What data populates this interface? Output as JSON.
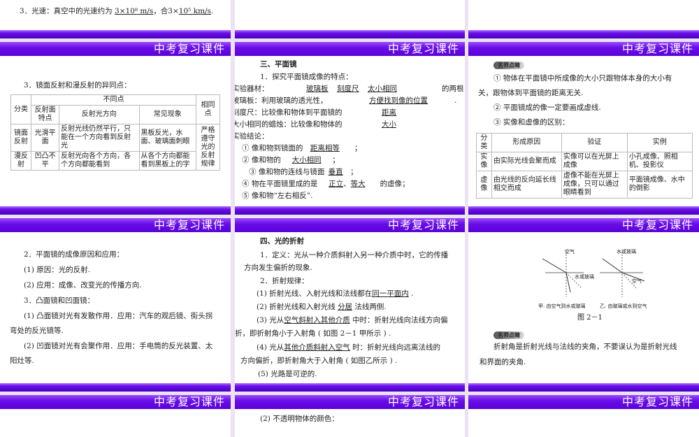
{
  "header_title": "中考复习课件",
  "slide_top_left": {
    "prefix": "3．光速：真空中的光速约为 ",
    "v1": "3×10⁸ m/s",
    "mid": "，合3×",
    "v2": "10⁵ km/s",
    "end": "."
  },
  "slide_r1c0": {
    "heading": "3．镜面反射和漫反射的异同点：",
    "table": {
      "h_class": "分类",
      "h_diff": "不同点",
      "h_same": "相同点",
      "h_surface": "反射面特点",
      "h_dir": "反射光方向",
      "h_phen": "常见现象",
      "rows": [
        {
          "cls": "镜面反射",
          "surface": "光滑平面",
          "dir": "反射光线仍然平行，只能在一个方向看到反射光",
          "phen": "黑板反光，水面、玻璃面刺眼"
        },
        {
          "cls": "漫反射",
          "surface": "凹凸不平",
          "dir": "反射光向各个方向，各个方向都能看到",
          "phen": "从各个方向都能看到黑板上的字"
        }
      ],
      "same": "严格遵守光的反射规律"
    }
  },
  "slide_r1c1": {
    "heading": "三、平面镜",
    "l1": "1．探究平面镜成像的特点：",
    "l2a": "实验器材：",
    "l2b": "玻璃板",
    "l2c": "刻度尺",
    "l2d": "太小相同",
    "l2e": "的两根",
    "l3a": "玻璃板：利用玻璃的透光性，",
    "l3b": "方便找到像的位置",
    "l3c": ".",
    "l4a": "刻度尺：比较像和物体到平面镜的",
    "l4b": "距离",
    "l5a": "大小相同的蜡烛：比较像和物体的",
    "l5b": "大小",
    "l6": "实验结论：",
    "c1a": "① 像和物到镜面的",
    "c1b": "距离相等",
    "c1c": "；",
    "c2a": "② 像和物的",
    "c2b": "大小相同",
    "c2c": "；",
    "c3a": "③ 像和物的连线与镜面",
    "c3b": "垂直",
    "c3c": "；",
    "c4a": "④ 物在平面镜里成的是",
    "c4b": "正立",
    "c4c": "、",
    "c4d": "等大",
    "c4e": "的虚像；",
    "c5": "⑤ 像和物“左右相反”."
  },
  "slide_r1c2": {
    "tip": "名师点睛",
    "l1": "① 物体在平面镜中所成像的大小只跟物体本身的大小有",
    "l2": "关，跟物体到平面镜的距离无关.",
    "l3": "② 平面镜成的像一定要画成虚线.",
    "l4": "③ 实像和虚像的区别：",
    "table": {
      "headers": [
        "分类",
        "形成原因",
        "验证",
        "实例"
      ],
      "rows": [
        [
          "实像",
          "由实际光线会聚而成",
          "实像可以在光屏上成像",
          "小孔成像、照相机、投影仪"
        ],
        [
          "虚像",
          "由光线的反向延长线相交而成",
          "虚像不能在光屏上成像，只可以通过眼睛看到",
          "平面镜成像、水中的倒影"
        ]
      ]
    }
  },
  "slide_r2c0": {
    "l1": "2．平面镜的成像原因和应用：",
    "l2": "(1) 原因：光的反射.",
    "l3": "(2) 应用：成像、改变光的传播方向.",
    "l4": "3．凸面镜和凹面镜：",
    "l5": "(1) 凸面镜对光有发散作用．应用：汽车的观后镜、街头拐",
    "l6": "弯处的反光镜等.",
    "l7": "(2) 凹面镜对光有会聚作用．应用：手电筒的反光装置、太",
    "l8": "阳灶等."
  },
  "slide_r2c1": {
    "heading": "四、光的折射",
    "l1": "1．定义：光从一种介质斜射入另一种介质中时，它的传播",
    "l2": "方向发生偏折的现象.",
    "l3": "2．折射规律：",
    "r1a": "(1) 折射光线、入射光线和法线都在",
    "r1b": "同一平面内",
    "r1c": ".",
    "r2a": "(2) 折射光线和入射光线",
    "r2b": "分居",
    "r2c": "法线两侧.",
    "r3a": "(3) 光从",
    "r3b": "空气斜射入其他介质",
    "r3c": "中时：折射光线向法线方向偏",
    "r3d": "折，即折射角小于入射角 ( 如图  2－1 甲所示 ) .",
    "r4a": "(4) 光从",
    "r4b": "其他介质斜射入空气",
    "r4c": "时：折射光线向远离法线的",
    "r4d": "方向偏折，即折射角大于入射角 ( 如图乙所示 ) .",
    "r5": "(5) 光路是可逆的."
  },
  "slide_r2c2": {
    "fig_a_top": "空气",
    "fig_a_bottom": "水或玻璃",
    "fig_a_caption": "甲. 由空气到水或玻璃",
    "fig_b_top": "水或玻璃",
    "fig_b_bottom": "空气",
    "fig_b_caption": "乙. 由玻璃或水到空气",
    "fig_label": "图  2－1",
    "tip": "名师点睛",
    "l1": "折射角是折射光线与法线的夹角，不要误认为是折射光线",
    "l2": "和界面的夹角."
  },
  "slide_r3c1": {
    "l1": "(2) 不透明物体的颜色："
  }
}
